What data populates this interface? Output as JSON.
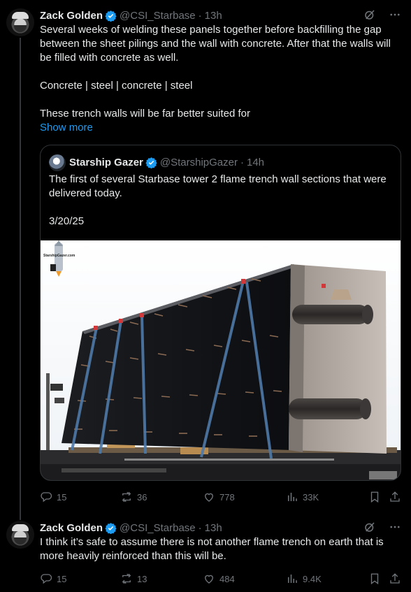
{
  "posts": [
    {
      "author": {
        "name": "Zack Golden",
        "handle": "@CSI_Starbase",
        "time": "13h"
      },
      "text": [
        "Several weeks of welding these panels together before backfilling the gap between the sheet pilings and the wall with concrete. After that the walls will be filled with concrete as well.",
        "Concrete | steel | concrete | steel",
        "These trench walls will be far better suited for"
      ],
      "show_more": "Show more",
      "quote": {
        "author": {
          "name": "Starship Gazer",
          "handle": "@StarshipGazer",
          "time": "14h"
        },
        "text": [
          "The first of several Starbase tower 2 flame trench wall sections that were delivered today.",
          "3/20/25"
        ],
        "image_alt": "Large black steel flame trench wall section strapped to a flatbed trailer",
        "watermark": "StarshipGazer.com"
      },
      "stats": {
        "replies": "15",
        "reposts": "36",
        "likes": "778",
        "views": "33K"
      }
    },
    {
      "author": {
        "name": "Zack Golden",
        "handle": "@CSI_Starbase",
        "time": "13h"
      },
      "text": [
        "I think it’s safe to assume there is not another flame trench on earth that is more heavily reinforced than this will be."
      ],
      "stats": {
        "replies": "15",
        "reposts": "13",
        "likes": "484",
        "views": "9.4K"
      }
    }
  ],
  "icons": {
    "verified": "verified-badge-icon",
    "grok": "grok-icon",
    "more": "more-icon",
    "reply": "reply-icon",
    "repost": "repost-icon",
    "like": "like-icon",
    "views": "views-icon",
    "bookmark": "bookmark-icon",
    "share": "share-icon"
  },
  "colors": {
    "background": "#000000",
    "text": "#e7e9ea",
    "muted": "#71767b",
    "accent": "#1d9bf0"
  }
}
